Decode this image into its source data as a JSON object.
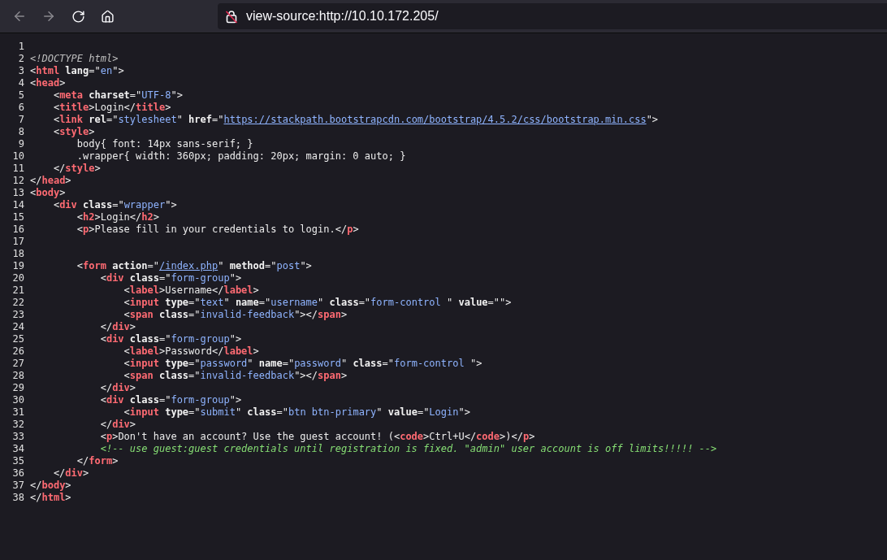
{
  "toolbar": {
    "buttons": [
      {
        "kind": "back",
        "disabled": true
      },
      {
        "kind": "forward",
        "disabled": true
      },
      {
        "kind": "reload",
        "disabled": false
      },
      {
        "kind": "home",
        "disabled": false
      }
    ],
    "url": "view-source:http://10.10.172.205/"
  },
  "source_lines": [
    {
      "number": "1"
    },
    {
      "number": "2",
      "tokens": [
        {
          "kind": "doctype",
          "text": "<!DOCTYPE html>"
        }
      ]
    },
    {
      "number": "3",
      "tokens": [
        {
          "kind": "punct",
          "text": "<"
        },
        {
          "kind": "tag",
          "text": "html"
        },
        {
          "kind": "attr",
          "text": " lang"
        },
        {
          "kind": "punct",
          "text": "=\""
        },
        {
          "kind": "val",
          "text": "en"
        },
        {
          "kind": "punct",
          "text": "\">"
        }
      ]
    },
    {
      "number": "4",
      "tokens": [
        {
          "kind": "punct",
          "text": "<"
        },
        {
          "kind": "tag",
          "text": "head"
        },
        {
          "kind": "punct",
          "text": ">"
        }
      ]
    },
    {
      "number": "5",
      "tokens": [
        {
          "kind": "punct",
          "text": "    <"
        },
        {
          "kind": "tag",
          "text": "meta"
        },
        {
          "kind": "attr",
          "text": " charset"
        },
        {
          "kind": "punct",
          "text": "=\""
        },
        {
          "kind": "val",
          "text": "UTF-8"
        },
        {
          "kind": "punct",
          "text": "\">"
        }
      ]
    },
    {
      "number": "6",
      "tokens": [
        {
          "kind": "punct",
          "text": "    <"
        },
        {
          "kind": "tag",
          "text": "title"
        },
        {
          "kind": "punct",
          "text": ">Login</"
        },
        {
          "kind": "tag",
          "text": "title"
        },
        {
          "kind": "punct",
          "text": ">"
        }
      ]
    },
    {
      "number": "7",
      "tokens": [
        {
          "kind": "punct",
          "text": "    <"
        },
        {
          "kind": "tag",
          "text": "link"
        },
        {
          "kind": "attr",
          "text": " rel"
        },
        {
          "kind": "punct",
          "text": "=\""
        },
        {
          "kind": "val",
          "text": "stylesheet"
        },
        {
          "kind": "punct",
          "text": "\""
        },
        {
          "kind": "attr",
          "text": " href"
        },
        {
          "kind": "punct",
          "text": "=\""
        },
        {
          "kind": "link",
          "text": "https://stackpath.bootstrapcdn.com/bootstrap/4.5.2/css/bootstrap.min.css"
        },
        {
          "kind": "punct",
          "text": "\">"
        }
      ]
    },
    {
      "number": "8",
      "tokens": [
        {
          "kind": "punct",
          "text": "    <"
        },
        {
          "kind": "tag",
          "text": "style"
        },
        {
          "kind": "punct",
          "text": ">"
        }
      ]
    },
    {
      "number": "9",
      "tokens": [
        {
          "kind": "punct",
          "text": "        body{ font: 14px sans-serif; }"
        }
      ]
    },
    {
      "number": "10",
      "tokens": [
        {
          "kind": "punct",
          "text": "        .wrapper{ width: 360px; padding: 20px; margin: 0 auto; }"
        }
      ]
    },
    {
      "number": "11",
      "tokens": [
        {
          "kind": "punct",
          "text": "    </"
        },
        {
          "kind": "tag",
          "text": "style"
        },
        {
          "kind": "punct",
          "text": ">"
        }
      ]
    },
    {
      "number": "12",
      "tokens": [
        {
          "kind": "punct",
          "text": "</"
        },
        {
          "kind": "tag",
          "text": "head"
        },
        {
          "kind": "punct",
          "text": ">"
        }
      ]
    },
    {
      "number": "13",
      "tokens": [
        {
          "kind": "punct",
          "text": "<"
        },
        {
          "kind": "tag",
          "text": "body"
        },
        {
          "kind": "punct",
          "text": ">"
        }
      ]
    },
    {
      "number": "14",
      "tokens": [
        {
          "kind": "punct",
          "text": "    <"
        },
        {
          "kind": "tag",
          "text": "div"
        },
        {
          "kind": "attr",
          "text": " class"
        },
        {
          "kind": "punct",
          "text": "=\""
        },
        {
          "kind": "val",
          "text": "wrapper"
        },
        {
          "kind": "punct",
          "text": "\">"
        }
      ]
    },
    {
      "number": "15",
      "tokens": [
        {
          "kind": "punct",
          "text": "        <"
        },
        {
          "kind": "tag",
          "text": "h2"
        },
        {
          "kind": "punct",
          "text": ">Login</"
        },
        {
          "kind": "tag",
          "text": "h2"
        },
        {
          "kind": "punct",
          "text": ">"
        }
      ]
    },
    {
      "number": "16",
      "tokens": [
        {
          "kind": "punct",
          "text": "        <"
        },
        {
          "kind": "tag",
          "text": "p"
        },
        {
          "kind": "punct",
          "text": ">Please fill in your credentials to login.</"
        },
        {
          "kind": "tag",
          "text": "p"
        },
        {
          "kind": "punct",
          "text": ">"
        }
      ]
    },
    {
      "number": "17"
    },
    {
      "number": "18"
    },
    {
      "number": "19",
      "tokens": [
        {
          "kind": "punct",
          "text": "        <"
        },
        {
          "kind": "tag",
          "text": "form"
        },
        {
          "kind": "attr",
          "text": " action"
        },
        {
          "kind": "punct",
          "text": "=\""
        },
        {
          "kind": "link",
          "text": "/index.php"
        },
        {
          "kind": "punct",
          "text": "\""
        },
        {
          "kind": "attr",
          "text": " method"
        },
        {
          "kind": "punct",
          "text": "=\""
        },
        {
          "kind": "val",
          "text": "post"
        },
        {
          "kind": "punct",
          "text": "\">"
        }
      ]
    },
    {
      "number": "20",
      "tokens": [
        {
          "kind": "punct",
          "text": "            <"
        },
        {
          "kind": "tag",
          "text": "div"
        },
        {
          "kind": "attr",
          "text": " class"
        },
        {
          "kind": "punct",
          "text": "=\""
        },
        {
          "kind": "val",
          "text": "form-group"
        },
        {
          "kind": "punct",
          "text": "\">"
        }
      ]
    },
    {
      "number": "21",
      "tokens": [
        {
          "kind": "punct",
          "text": "                <"
        },
        {
          "kind": "tag",
          "text": "label"
        },
        {
          "kind": "punct",
          "text": ">Username</"
        },
        {
          "kind": "tag",
          "text": "label"
        },
        {
          "kind": "punct",
          "text": ">"
        }
      ]
    },
    {
      "number": "22",
      "tokens": [
        {
          "kind": "punct",
          "text": "                <"
        },
        {
          "kind": "tag",
          "text": "input"
        },
        {
          "kind": "attr",
          "text": " type"
        },
        {
          "kind": "punct",
          "text": "=\""
        },
        {
          "kind": "val",
          "text": "text"
        },
        {
          "kind": "punct",
          "text": "\""
        },
        {
          "kind": "attr",
          "text": " name"
        },
        {
          "kind": "punct",
          "text": "=\""
        },
        {
          "kind": "val",
          "text": "username"
        },
        {
          "kind": "punct",
          "text": "\""
        },
        {
          "kind": "attr",
          "text": " class"
        },
        {
          "kind": "punct",
          "text": "=\""
        },
        {
          "kind": "val",
          "text": "form-control "
        },
        {
          "kind": "punct",
          "text": "\""
        },
        {
          "kind": "attr",
          "text": " value"
        },
        {
          "kind": "punct",
          "text": "=\"\">"
        }
      ]
    },
    {
      "number": "23",
      "tokens": [
        {
          "kind": "punct",
          "text": "                <"
        },
        {
          "kind": "tag",
          "text": "span"
        },
        {
          "kind": "attr",
          "text": " class"
        },
        {
          "kind": "punct",
          "text": "=\""
        },
        {
          "kind": "val",
          "text": "invalid-feedback"
        },
        {
          "kind": "punct",
          "text": "\"></"
        },
        {
          "kind": "tag",
          "text": "span"
        },
        {
          "kind": "punct",
          "text": ">"
        }
      ]
    },
    {
      "number": "24",
      "tokens": [
        {
          "kind": "punct",
          "text": "            </"
        },
        {
          "kind": "tag",
          "text": "div"
        },
        {
          "kind": "punct",
          "text": ">"
        }
      ]
    },
    {
      "number": "25",
      "tokens": [
        {
          "kind": "punct",
          "text": "            <"
        },
        {
          "kind": "tag",
          "text": "div"
        },
        {
          "kind": "attr",
          "text": " class"
        },
        {
          "kind": "punct",
          "text": "=\""
        },
        {
          "kind": "val",
          "text": "form-group"
        },
        {
          "kind": "punct",
          "text": "\">"
        }
      ]
    },
    {
      "number": "26",
      "tokens": [
        {
          "kind": "punct",
          "text": "                <"
        },
        {
          "kind": "tag",
          "text": "label"
        },
        {
          "kind": "punct",
          "text": ">Password</"
        },
        {
          "kind": "tag",
          "text": "label"
        },
        {
          "kind": "punct",
          "text": ">"
        }
      ]
    },
    {
      "number": "27",
      "tokens": [
        {
          "kind": "punct",
          "text": "                <"
        },
        {
          "kind": "tag",
          "text": "input"
        },
        {
          "kind": "attr",
          "text": " type"
        },
        {
          "kind": "punct",
          "text": "=\""
        },
        {
          "kind": "val",
          "text": "password"
        },
        {
          "kind": "punct",
          "text": "\""
        },
        {
          "kind": "attr",
          "text": " name"
        },
        {
          "kind": "punct",
          "text": "=\""
        },
        {
          "kind": "val",
          "text": "password"
        },
        {
          "kind": "punct",
          "text": "\""
        },
        {
          "kind": "attr",
          "text": " class"
        },
        {
          "kind": "punct",
          "text": "=\""
        },
        {
          "kind": "val",
          "text": "form-control "
        },
        {
          "kind": "punct",
          "text": "\">"
        }
      ]
    },
    {
      "number": "28",
      "tokens": [
        {
          "kind": "punct",
          "text": "                <"
        },
        {
          "kind": "tag",
          "text": "span"
        },
        {
          "kind": "attr",
          "text": " class"
        },
        {
          "kind": "punct",
          "text": "=\""
        },
        {
          "kind": "val",
          "text": "invalid-feedback"
        },
        {
          "kind": "punct",
          "text": "\"></"
        },
        {
          "kind": "tag",
          "text": "span"
        },
        {
          "kind": "punct",
          "text": ">"
        }
      ]
    },
    {
      "number": "29",
      "tokens": [
        {
          "kind": "punct",
          "text": "            </"
        },
        {
          "kind": "tag",
          "text": "div"
        },
        {
          "kind": "punct",
          "text": ">"
        }
      ]
    },
    {
      "number": "30",
      "tokens": [
        {
          "kind": "punct",
          "text": "            <"
        },
        {
          "kind": "tag",
          "text": "div"
        },
        {
          "kind": "attr",
          "text": " class"
        },
        {
          "kind": "punct",
          "text": "=\""
        },
        {
          "kind": "val",
          "text": "form-group"
        },
        {
          "kind": "punct",
          "text": "\">"
        }
      ]
    },
    {
      "number": "31",
      "tokens": [
        {
          "kind": "punct",
          "text": "                <"
        },
        {
          "kind": "tag",
          "text": "input"
        },
        {
          "kind": "attr",
          "text": " type"
        },
        {
          "kind": "punct",
          "text": "=\""
        },
        {
          "kind": "val",
          "text": "submit"
        },
        {
          "kind": "punct",
          "text": "\""
        },
        {
          "kind": "attr",
          "text": " class"
        },
        {
          "kind": "punct",
          "text": "=\""
        },
        {
          "kind": "val",
          "text": "btn btn-primary"
        },
        {
          "kind": "punct",
          "text": "\""
        },
        {
          "kind": "attr",
          "text": " value"
        },
        {
          "kind": "punct",
          "text": "=\""
        },
        {
          "kind": "val",
          "text": "Login"
        },
        {
          "kind": "punct",
          "text": "\">"
        }
      ]
    },
    {
      "number": "32",
      "tokens": [
        {
          "kind": "punct",
          "text": "            </"
        },
        {
          "kind": "tag",
          "text": "div"
        },
        {
          "kind": "punct",
          "text": ">"
        }
      ]
    },
    {
      "number": "33",
      "tokens": [
        {
          "kind": "punct",
          "text": "            <"
        },
        {
          "kind": "tag",
          "text": "p"
        },
        {
          "kind": "punct",
          "text": ">Don't have an account? Use the guest account! (<"
        },
        {
          "kind": "tag",
          "text": "code"
        },
        {
          "kind": "punct",
          "text": ">Ctrl+U</"
        },
        {
          "kind": "tag",
          "text": "code"
        },
        {
          "kind": "punct",
          "text": ">)</"
        },
        {
          "kind": "tag",
          "text": "p"
        },
        {
          "kind": "punct",
          "text": ">"
        }
      ]
    },
    {
      "number": "34",
      "tokens": [
        {
          "kind": "comment",
          "text": "            <!-- use guest:guest credentials until registration is fixed. \"admin\" user account is off limits!!!!! -->"
        }
      ]
    },
    {
      "number": "35",
      "tokens": [
        {
          "kind": "punct",
          "text": "        </"
        },
        {
          "kind": "tag",
          "text": "form"
        },
        {
          "kind": "punct",
          "text": ">"
        }
      ]
    },
    {
      "number": "36",
      "tokens": [
        {
          "kind": "punct",
          "text": "    </"
        },
        {
          "kind": "tag",
          "text": "div"
        },
        {
          "kind": "punct",
          "text": ">"
        }
      ]
    },
    {
      "number": "37",
      "tokens": [
        {
          "kind": "punct",
          "text": "</"
        },
        {
          "kind": "tag",
          "text": "body"
        },
        {
          "kind": "punct",
          "text": ">"
        }
      ]
    },
    {
      "number": "38",
      "tokens": [
        {
          "kind": "punct",
          "text": "</"
        },
        {
          "kind": "tag",
          "text": "html"
        },
        {
          "kind": "punct",
          "text": ">"
        }
      ]
    }
  ]
}
